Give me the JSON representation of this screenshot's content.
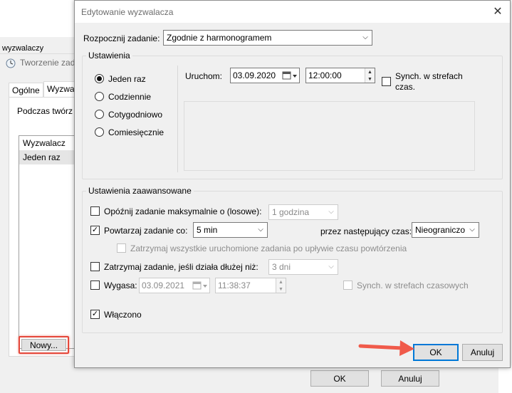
{
  "background": {
    "window_title": "wyzwalaczy",
    "dialog_title": "Tworzenie zada",
    "tabs": [
      "Ogólne",
      "Wyzwa"
    ],
    "description": "Podczas twórz",
    "list": {
      "header": "Wyzwalacz",
      "rows": [
        "Jeden raz"
      ]
    },
    "new_button": "Nowy...",
    "ok_button": "OK",
    "cancel_button": "Anuluj"
  },
  "dialog": {
    "title": "Edytowanie wyzwalacza",
    "close_icon": "close-icon",
    "start_task_label": "Rozpocznij zadanie:",
    "start_task_value": "Zgodnie z harmonogramem",
    "settings": {
      "title": "Ustawienia",
      "options": [
        "Jeden raz",
        "Codziennie",
        "Cotygodniowo",
        "Comiesięcznie"
      ],
      "selected_option": "Jeden raz",
      "start_label": "Uruchom:",
      "start_date": "03.09.2020",
      "start_time": "12:00:00",
      "sync_label_line1": "Synch. w strefach",
      "sync_label_line2": "czas."
    },
    "advanced": {
      "title": "Ustawienia zaawansowane",
      "delay_label": "Opóźnij zadanie maksymalnie o (losowe):",
      "delay_value": "1 godzina",
      "repeat_label": "Powtarzaj zadanie co:",
      "repeat_value": "5 min",
      "repeat_duration_label": "przez następujący czas:",
      "repeat_duration_value": "Nieograniczo",
      "stop_all_label": "Zatrzymaj wszystkie uruchomione zadania po upływie czasu powtórzenia",
      "stop_if_label": "Zatrzymaj zadanie, jeśli działa dłużej niż:",
      "stop_if_value": "3 dni",
      "expire_label": "Wygasa:",
      "expire_date": "03.09.2021",
      "expire_time": "11:38:37",
      "expire_sync_label": "Synch. w strefach czasowych",
      "enabled_label": "Włączono"
    },
    "ok_button": "OK",
    "cancel_button": "Anuluj"
  },
  "colors": {
    "highlight": "#e4473a",
    "arrow": "#f05a4a",
    "default_button_border": "#0078d7"
  }
}
